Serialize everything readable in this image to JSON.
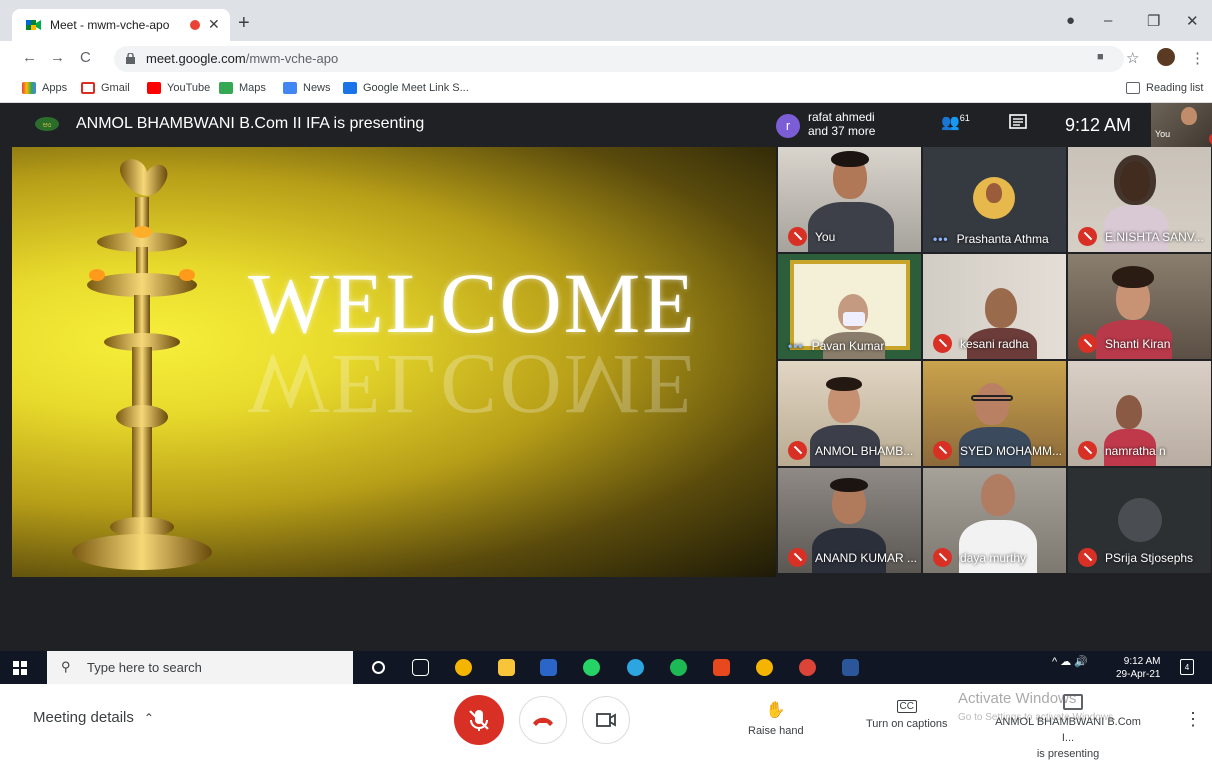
{
  "browser": {
    "tab_title": "Meet - mwm-vche-apo",
    "url_host": "meet.google.com",
    "url_path": "/mwm-vche-apo",
    "bookmarks": [
      {
        "label": "Apps",
        "color": "#ea4335"
      },
      {
        "label": "Gmail",
        "color": "#d93025"
      },
      {
        "label": "YouTube",
        "color": "#ff0000"
      },
      {
        "label": "Maps",
        "color": "#34a853"
      },
      {
        "label": "News",
        "color": "#4285f4"
      },
      {
        "label": "Google Meet Link S...",
        "color": "#1a73e8"
      }
    ],
    "reading_list": "Reading list"
  },
  "meet": {
    "presenting_banner": "ANMOL BHAMBWANI B.Com II IFA is presenting",
    "roster_initial": "r",
    "roster_line1": "rafat ahmedi",
    "roster_line2": "and 37 more",
    "participant_count": "61",
    "time": "9:12 AM",
    "self_label": "You",
    "slide_title": "WELCOME",
    "slide_reflection": "WELCOME",
    "tiles": [
      {
        "name": "You",
        "status": "muted"
      },
      {
        "name": "Prashanta Athma",
        "status": "speaking"
      },
      {
        "name": "E.NISHTA SANV...",
        "status": "muted"
      },
      {
        "name": "Pavan Kumar",
        "status": "speaking"
      },
      {
        "name": "kesani radha",
        "status": "muted"
      },
      {
        "name": "Shanti Kiran",
        "status": "muted"
      },
      {
        "name": "ANMOL BHAMB...",
        "status": "muted"
      },
      {
        "name": "SYED MOHAMM...",
        "status": "muted"
      },
      {
        "name": "namratha n",
        "status": "muted"
      },
      {
        "name": "ANAND KUMAR ...",
        "status": "muted"
      },
      {
        "name": "daya murthy",
        "status": "muted"
      },
      {
        "name": "PSrija Stjosephs",
        "status": "muted"
      }
    ],
    "bottom": {
      "meeting_details": "Meeting details",
      "raise_hand": "Raise hand",
      "captions": "Turn on captions",
      "presenting_line1": "ANMOL BHAMBWANI B.Com I...",
      "presenting_line2": "is presenting",
      "activate_title": "Activate Windows",
      "activate_sub": "Go to Settings to activate Windows."
    }
  },
  "taskbar": {
    "search_placeholder": "Type here to search",
    "time": "9:12 AM",
    "date": "29-Apr-21",
    "notifications": "4"
  },
  "colors": {
    "mute_red": "#d93025",
    "meet_dark": "#202124",
    "speaking_blue": "#8ab4f8"
  }
}
